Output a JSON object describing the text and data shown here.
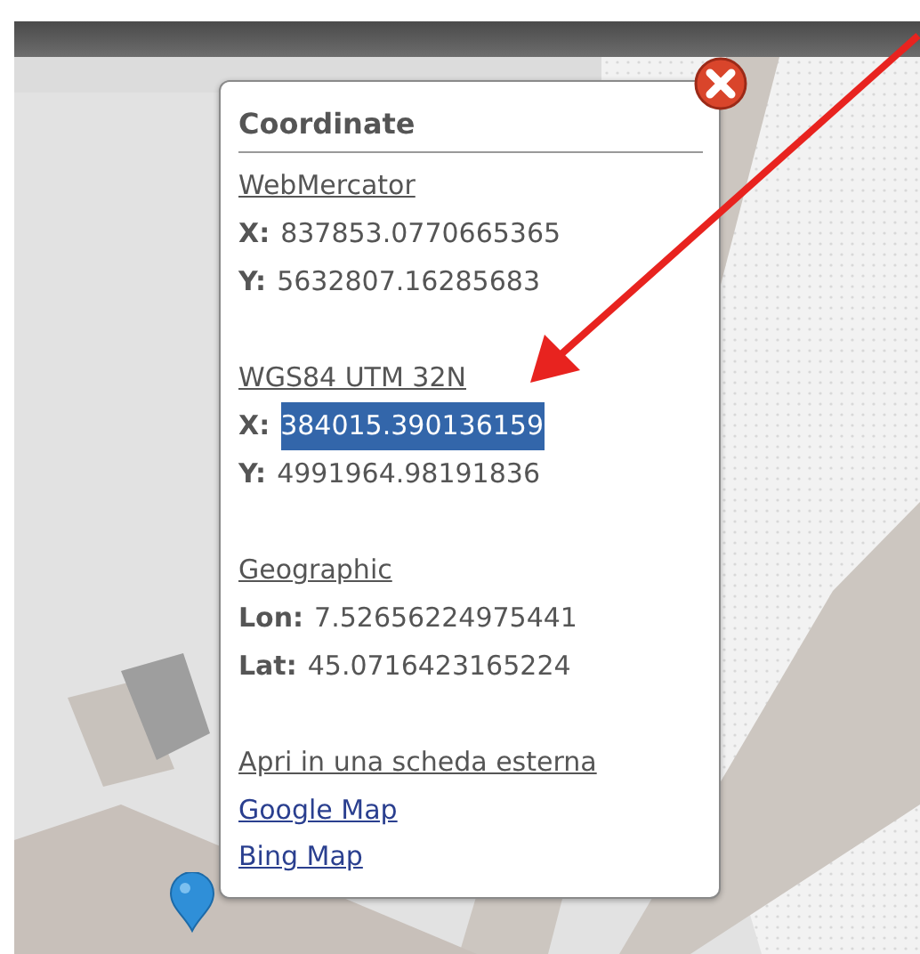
{
  "popup": {
    "title": "Coordinate",
    "sections": [
      {
        "heading": "WebMercator",
        "rows": [
          {
            "label": "X:",
            "value": "837853.0770665365",
            "selected": false
          },
          {
            "label": "Y:",
            "value": "5632807.16285683",
            "selected": false
          }
        ]
      },
      {
        "heading": "WGS84 UTM 32N",
        "rows": [
          {
            "label": "X:",
            "value": "384015.390136159",
            "selected": true
          },
          {
            "label": "Y:",
            "value": "4991964.98191836",
            "selected": false
          }
        ]
      },
      {
        "heading": "Geographic",
        "rows": [
          {
            "label": "Lon:",
            "value": "7.52656224975441",
            "selected": false
          },
          {
            "label": "Lat:",
            "value": "45.0716423165224",
            "selected": false
          }
        ]
      }
    ],
    "links_heading": "Apri in una scheda esterna",
    "links": [
      "Google Map",
      "Bing Map"
    ]
  }
}
